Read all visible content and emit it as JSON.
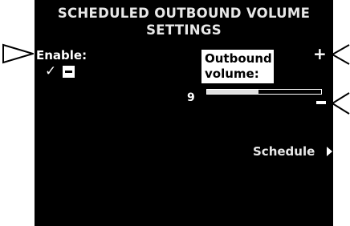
{
  "screen": {
    "title_line1": "SCHEDULED OUTBOUND VOLUME",
    "title_line2": "SETTINGS"
  },
  "enable": {
    "label": "Enable:",
    "checkmark": "✓",
    "enabled": true
  },
  "volume": {
    "label": "Outbound volume:",
    "value": "9",
    "level_fraction": 0.45,
    "increase_glyph": "+"
  },
  "schedule": {
    "label": "Schedule"
  },
  "colors": {
    "screen_bg": "#000000",
    "text": "#ffffff",
    "callout_stroke": "#000000"
  },
  "icons": [
    "enable-pointer-icon",
    "checkmark-icon",
    "minus-box-icon",
    "plus-icon",
    "minus-icon",
    "chevron-right-icon",
    "plus-pointer-icon",
    "minus-pointer-icon"
  ]
}
